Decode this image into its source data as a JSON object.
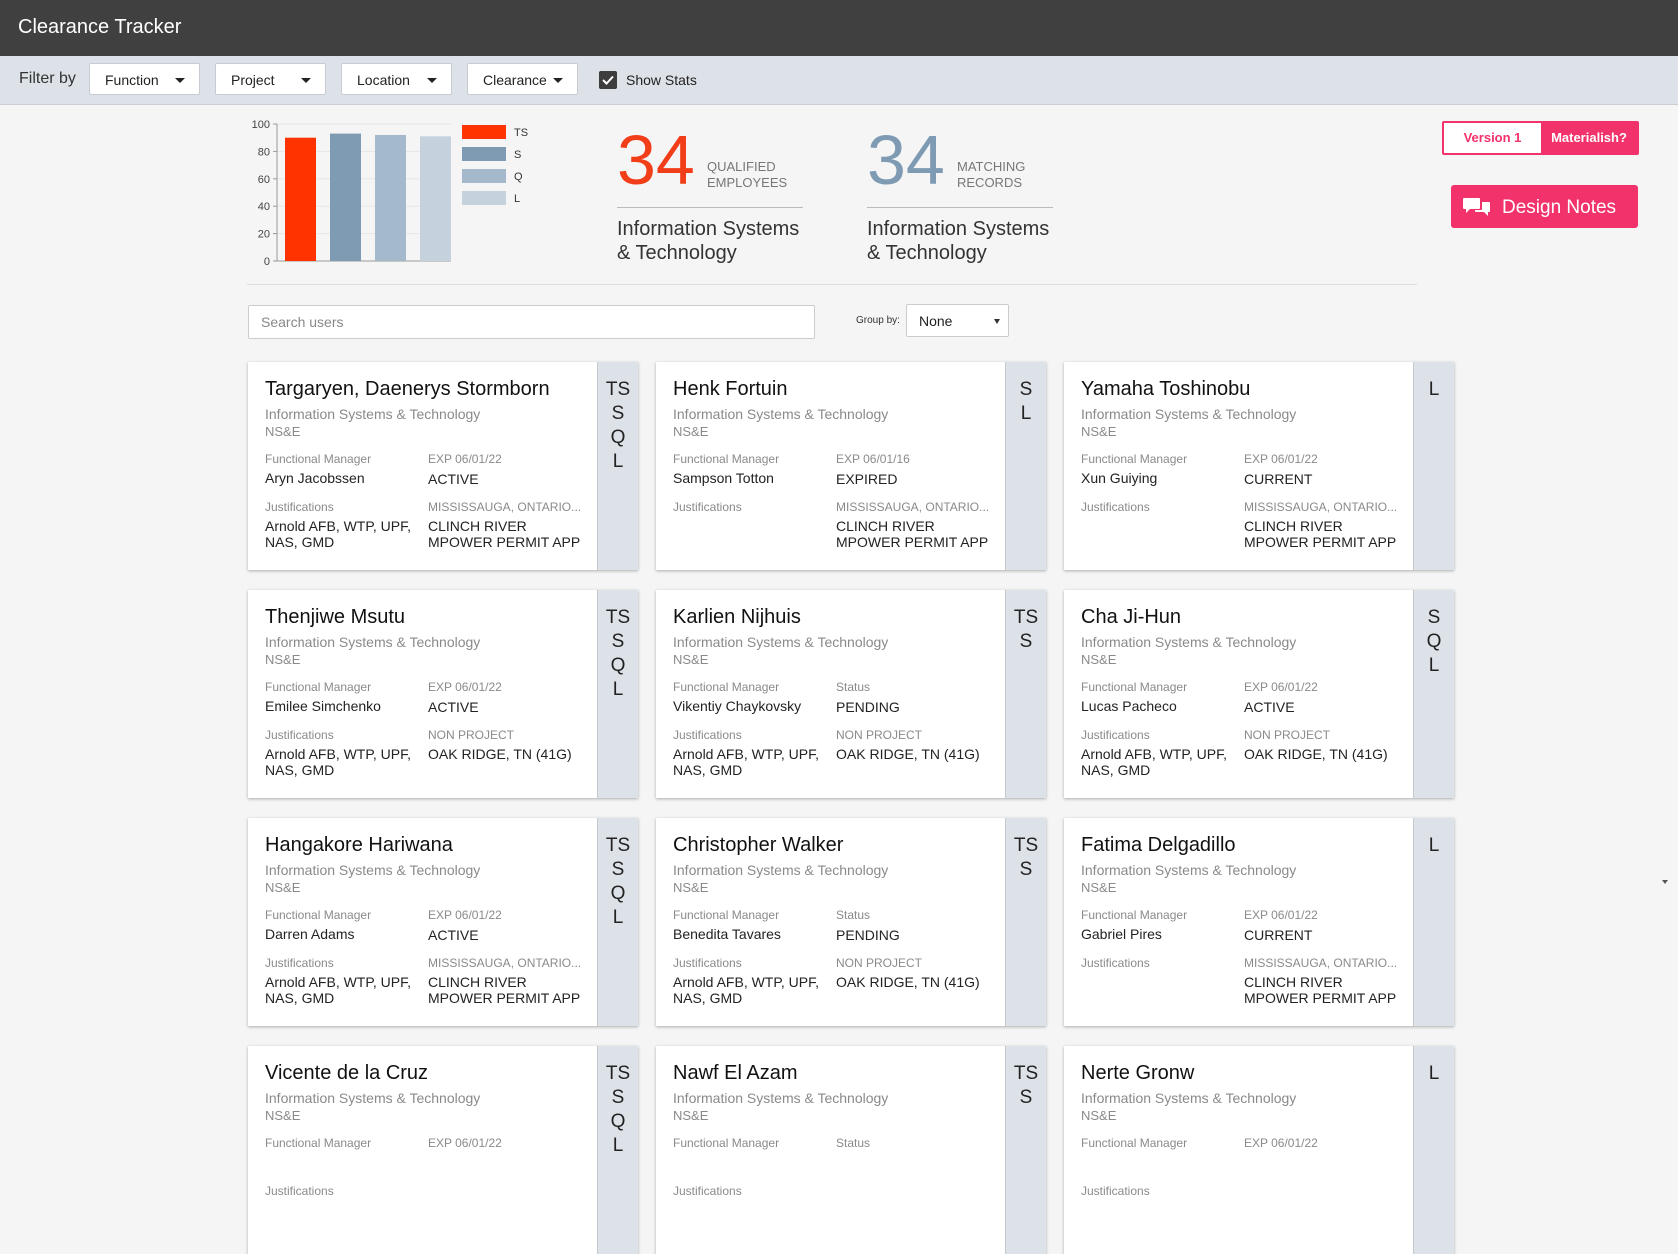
{
  "app": {
    "title": "Clearance Tracker"
  },
  "filter": {
    "label": "Filter by",
    "dropdowns": [
      "Function",
      "Project",
      "Location",
      "Clearance"
    ],
    "show_stats": "Show Stats"
  },
  "chart_data": {
    "type": "bar",
    "categories": [
      "TS",
      "S",
      "Q",
      "L"
    ],
    "values": [
      90,
      93,
      92,
      91
    ],
    "colors": [
      "#ff3300",
      "#7e9bb3",
      "#a5b9cc",
      "#c5d1dc"
    ],
    "ylim": [
      0,
      100
    ],
    "yticks": [
      0,
      20,
      40,
      60,
      80,
      100
    ],
    "legend": [
      "TS",
      "S",
      "Q",
      "L"
    ],
    "legend_position": "right"
  },
  "stats": [
    {
      "value": "34",
      "label_line1": "QUALIFIED",
      "label_line2": "EMPLOYEES",
      "desc_line1": "Information Systems",
      "desc_line2": "& Technology",
      "color": "#f23d19"
    },
    {
      "value": "34",
      "label_line1": "MATCHING",
      "label_line2": "RECORDS",
      "desc_line1": "Information Systems",
      "desc_line2": "& Technology",
      "color": "#7e9bb3"
    }
  ],
  "search": {
    "placeholder": "Search users"
  },
  "group_by": {
    "label": "Group by:",
    "value": "None"
  },
  "buttons": {
    "version": "Version 1",
    "materialish": "Materialish?",
    "design_notes": "Design Notes"
  },
  "card_labels": {
    "fm": "Functional Manager",
    "just": "Justifications"
  },
  "cards": [
    {
      "name": "Targaryen, Daenerys Stormborn",
      "dept": "Information Systems & Technology",
      "unit": "NS&E",
      "levels": [
        "TS",
        "S",
        "Q",
        "L"
      ],
      "fm": "Aryn Jacobssen",
      "status_label": "EXP 06/01/22",
      "status": "ACTIVE",
      "just_line1": "Arnold AFB, WTP, UPF,",
      "just_line2": "NAS, GMD",
      "loc_label": "MISSISSAUGA, ONTARIO...",
      "loc_line1": "CLINCH RIVER",
      "loc_line2": "MPOWER PERMIT APP"
    },
    {
      "name": "Henk Fortuin",
      "dept": "Information Systems & Technology",
      "unit": "NS&E",
      "levels": [
        "S",
        "L"
      ],
      "fm": "Sampson Totton",
      "status_label": "EXP 06/01/16",
      "status": "EXPIRED",
      "just_line1": "",
      "just_line2": "",
      "loc_label": "MISSISSAUGA, ONTARIO...",
      "loc_line1": "CLINCH RIVER",
      "loc_line2": "MPOWER PERMIT APP"
    },
    {
      "name": "Yamaha Toshinobu",
      "dept": "Information Systems & Technology",
      "unit": "NS&E",
      "levels": [
        "L"
      ],
      "fm": "Xun Guiying",
      "status_label": "EXP 06/01/22",
      "status": "CURRENT",
      "just_line1": "",
      "just_line2": "",
      "loc_label": "MISSISSAUGA, ONTARIO...",
      "loc_line1": "CLINCH RIVER",
      "loc_line2": "MPOWER PERMIT APP"
    },
    {
      "name": "Thenjiwe Msutu",
      "dept": "Information Systems & Technology",
      "unit": "NS&E",
      "levels": [
        "TS",
        "S",
        "Q",
        "L"
      ],
      "fm": "Emilee Simchenko",
      "status_label": "EXP 06/01/22",
      "status": "ACTIVE",
      "just_line1": "Arnold AFB, WTP, UPF,",
      "just_line2": "NAS, GMD",
      "loc_label": "NON PROJECT",
      "loc_line1": "OAK RIDGE, TN (41G)",
      "loc_line2": ""
    },
    {
      "name": "Karlien Nijhuis",
      "dept": "Information Systems & Technology",
      "unit": "NS&E",
      "levels": [
        "TS",
        "S"
      ],
      "fm": "Vikentiy Chaykovsky",
      "status_label": "Status",
      "status": "PENDING",
      "just_line1": "Arnold AFB, WTP, UPF,",
      "just_line2": "NAS, GMD",
      "loc_label": "NON PROJECT",
      "loc_line1": "OAK RIDGE, TN (41G)",
      "loc_line2": ""
    },
    {
      "name": "Cha Ji-Hun",
      "dept": "Information Systems & Technology",
      "unit": "NS&E",
      "levels": [
        "S",
        "Q",
        "L"
      ],
      "fm": "Lucas Pacheco",
      "status_label": "EXP 06/01/22",
      "status": "ACTIVE",
      "just_line1": "Arnold AFB, WTP, UPF,",
      "just_line2": "NAS, GMD",
      "loc_label": "NON PROJECT",
      "loc_line1": "OAK RIDGE, TN (41G)",
      "loc_line2": ""
    },
    {
      "name": "Hangakore Hariwana",
      "dept": "Information Systems & Technology",
      "unit": "NS&E",
      "levels": [
        "TS",
        "S",
        "Q",
        "L"
      ],
      "fm": "Darren Adams",
      "status_label": "EXP 06/01/22",
      "status": "ACTIVE",
      "just_line1": "Arnold AFB, WTP, UPF,",
      "just_line2": "NAS, GMD",
      "loc_label": "MISSISSAUGA, ONTARIO...",
      "loc_line1": "CLINCH RIVER",
      "loc_line2": "MPOWER PERMIT APP"
    },
    {
      "name": "Christopher Walker",
      "dept": "Information Systems & Technology",
      "unit": "NS&E",
      "levels": [
        "TS",
        "S"
      ],
      "fm": "Benedita Tavares",
      "status_label": "Status",
      "status": "PENDING",
      "just_line1": "Arnold AFB, WTP, UPF,",
      "just_line2": "NAS, GMD",
      "loc_label": "NON PROJECT",
      "loc_line1": "OAK RIDGE, TN (41G)",
      "loc_line2": ""
    },
    {
      "name": "Fatima Delgadillo",
      "dept": "Information Systems & Technology",
      "unit": "NS&E",
      "levels": [
        "L"
      ],
      "fm": "Gabriel Pires",
      "status_label": "EXP 06/01/22",
      "status": "CURRENT",
      "just_line1": "",
      "just_line2": "",
      "loc_label": "MISSISSAUGA, ONTARIO...",
      "loc_line1": "CLINCH RIVER",
      "loc_line2": "MPOWER PERMIT APP"
    },
    {
      "name": "Vicente de la Cruz",
      "dept": "Information Systems & Technology",
      "unit": "NS&E",
      "levels": [
        "TS",
        "S",
        "Q",
        "L"
      ],
      "fm": "",
      "status_label": "EXP 06/01/22",
      "status": "",
      "just_line1": "",
      "just_line2": "",
      "loc_label": "",
      "loc_line1": "",
      "loc_line2": ""
    },
    {
      "name": "Nawf El Azam",
      "dept": "Information Systems & Technology",
      "unit": "NS&E",
      "levels": [
        "TS",
        "S"
      ],
      "fm": "",
      "status_label": "Status",
      "status": "",
      "just_line1": "",
      "just_line2": "",
      "loc_label": "",
      "loc_line1": "",
      "loc_line2": ""
    },
    {
      "name": "Nerte Gronw",
      "dept": "Information Systems & Technology",
      "unit": "NS&E",
      "levels": [
        "L"
      ],
      "fm": "",
      "status_label": "EXP 06/01/22",
      "status": "",
      "just_line1": "",
      "just_line2": "",
      "loc_label": "",
      "loc_line1": "",
      "loc_line2": ""
    }
  ]
}
